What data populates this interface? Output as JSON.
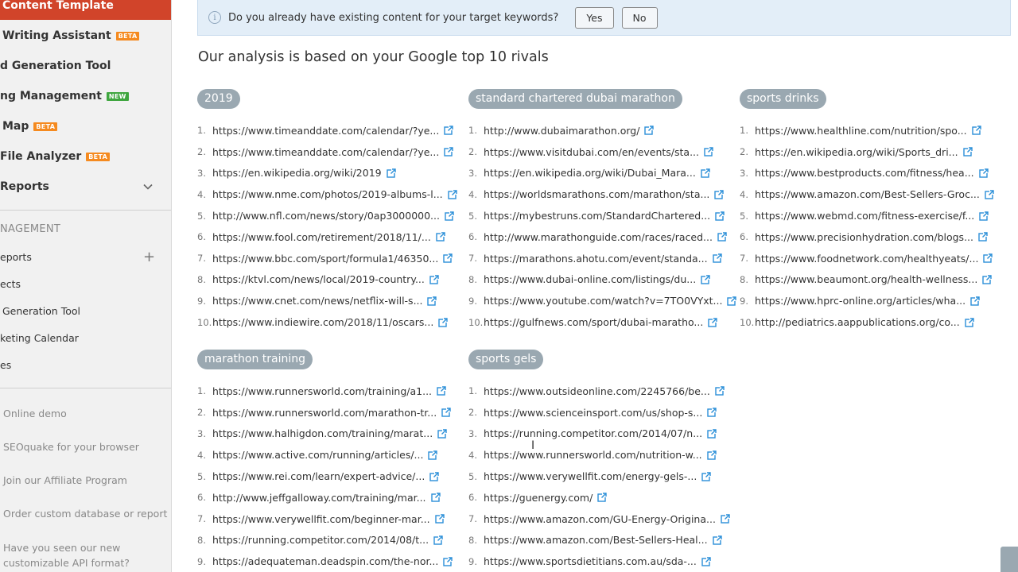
{
  "sidebar": {
    "active_item": "Content Template",
    "tools": [
      {
        "label": "Writing Assistant",
        "badge": "BETA"
      },
      {
        "label": "d Generation Tool",
        "badge": ""
      },
      {
        "label": "ng Management",
        "badge": "NEW"
      },
      {
        "label": "Map",
        "badge": "BETA"
      },
      {
        "label": "File Analyzer",
        "badge": "BETA"
      },
      {
        "label": "Reports",
        "badge": ""
      }
    ],
    "section_title": "NAGEMENT",
    "management_items": [
      "eports",
      "ects",
      "Generation Tool",
      "keting Calendar",
      "es"
    ],
    "links": [
      "Online demo",
      "SEOquake for your browser",
      "Join our Affiliate Program",
      "Order custom database or report",
      "Have you seen our new customizable API format?"
    ]
  },
  "banner": {
    "question": "Do you already have existing content for your target keywords?",
    "yes_label": "Yes",
    "no_label": "No"
  },
  "analysis_title": "Our analysis is based on your Google top 10 rivals",
  "groups": [
    {
      "keyword": "2019",
      "urls": [
        "https://www.timeanddate.com/calendar/?ye...",
        "https://www.timeanddate.com/calendar/?ye...",
        "https://en.wikipedia.org/wiki/2019",
        "https://www.nme.com/photos/2019-albums-l...",
        "http://www.nfl.com/news/story/0ap3000000...",
        "https://www.fool.com/retirement/2018/11/...",
        "https://www.bbc.com/sport/formula1/46350...",
        "https://ktvl.com/news/local/2019-country...",
        "https://www.cnet.com/news/netflix-will-s...",
        "https://www.indiewire.com/2018/11/oscars..."
      ]
    },
    {
      "keyword": "standard chartered dubai marathon",
      "urls": [
        "http://www.dubaimarathon.org/",
        "https://www.visitdubai.com/en/events/sta...",
        "https://en.wikipedia.org/wiki/Dubai_Mara...",
        "https://worldsmarathons.com/marathon/sta...",
        "https://mybestruns.com/StandardChartered...",
        "http://www.marathonguide.com/races/raced...",
        "https://marathons.ahotu.com/event/standa...",
        "https://www.dubai-online.com/listings/du...",
        "https://www.youtube.com/watch?v=7TO0VYxt...",
        "https://gulfnews.com/sport/dubai-maratho..."
      ]
    },
    {
      "keyword": "sports drinks",
      "urls": [
        "https://www.healthline.com/nutrition/spo...",
        "https://en.wikipedia.org/wiki/Sports_dri...",
        "https://www.bestproducts.com/fitness/hea...",
        "https://www.amazon.com/Best-Sellers-Groc...",
        "https://www.webmd.com/fitness-exercise/f...",
        "https://www.precisionhydration.com/blogs...",
        "https://www.foodnetwork.com/healthyeats/...",
        "https://www.beaumont.org/health-wellness...",
        "https://www.hprc-online.org/articles/wha...",
        "http://pediatrics.aappublications.org/co..."
      ]
    },
    {
      "keyword": "marathon training",
      "urls": [
        "https://www.runnersworld.com/training/a1...",
        "https://www.runnersworld.com/marathon-tr...",
        "https://www.halhigdon.com/training/marat...",
        "https://www.active.com/running/articles/...",
        "https://www.rei.com/learn/expert-advice/...",
        "http://www.jeffgalloway.com/training/mar...",
        "https://www.verywellfit.com/beginner-mar...",
        "https://running.competitor.com/2014/08/t...",
        "https://adequateman.deadspin.com/the-nor..."
      ]
    },
    {
      "keyword": "sports gels",
      "urls": [
        "https://www.outsideonline.com/2245766/be...",
        "https://www.scienceinsport.com/us/shop-s...",
        "https://running.competitor.com/2014/07/n...",
        "https://www.runnersworld.com/nutrition-w...",
        "https://www.verywellfit.com/energy-gels-...",
        "https://guenergy.com/",
        "https://www.amazon.com/GU-Energy-Origina...",
        "https://www.amazon.com/Best-Sellers-Heal...",
        "https://www.sportsdietitians.com.au/sda-..."
      ]
    }
  ]
}
